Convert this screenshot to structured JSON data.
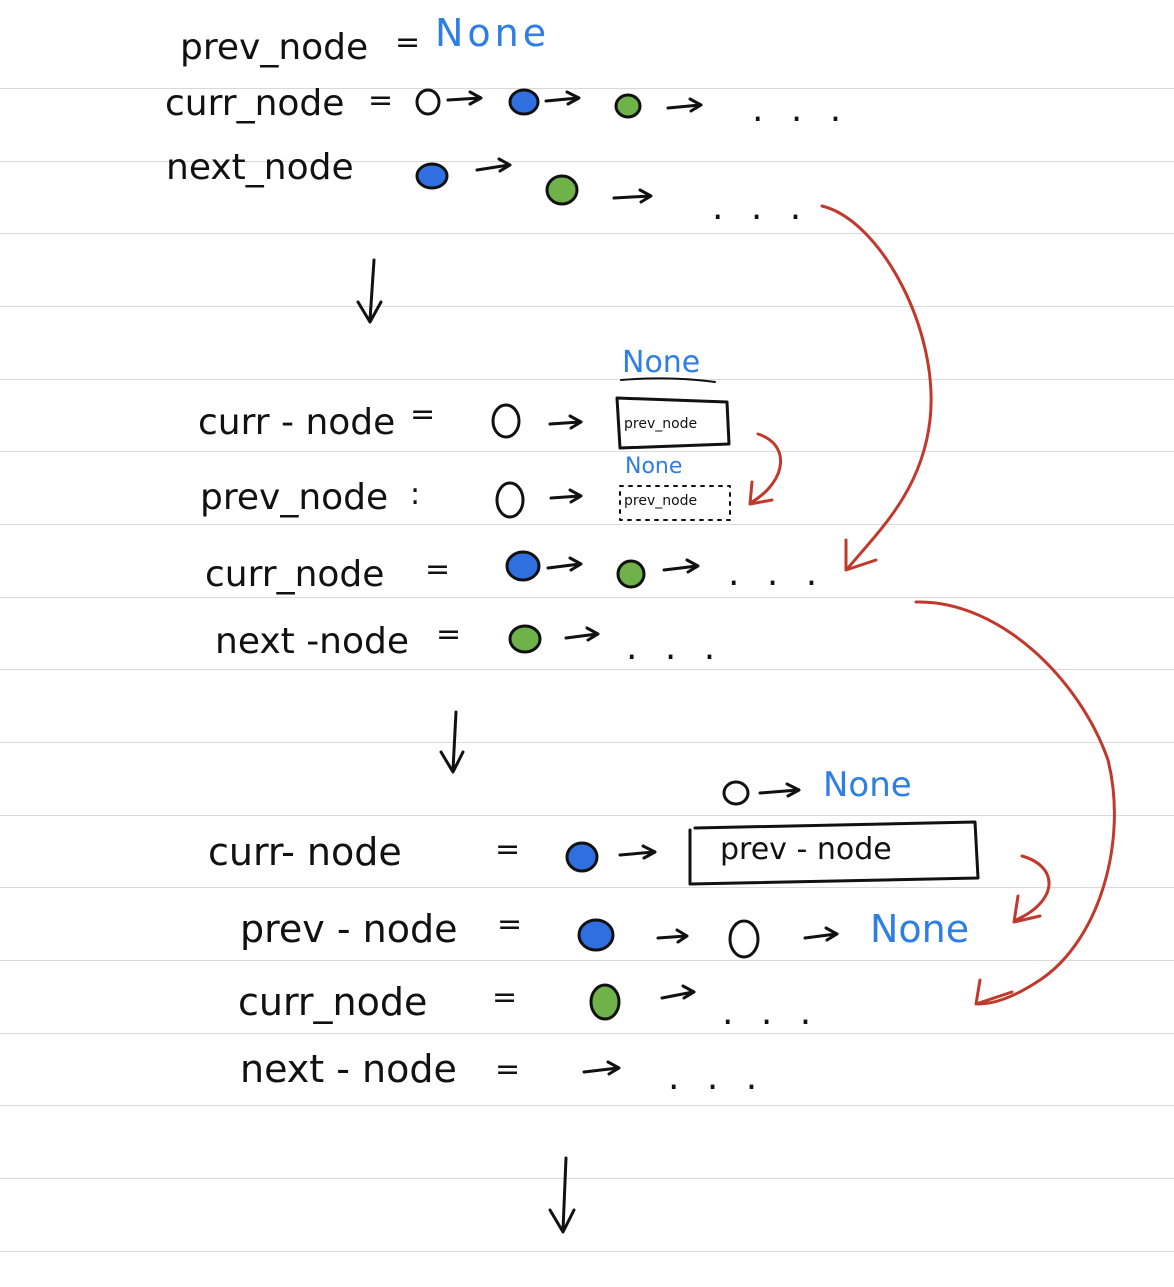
{
  "colors": {
    "ink": "#111111",
    "none_text": "#2f7ee6",
    "blue_node": "#2f6fe0",
    "green_node": "#6fb24a",
    "red_arrow": "#c0392b",
    "rule": "#d9d9d9"
  },
  "step1": {
    "prev_label": "prev_node",
    "prev_eq": "=",
    "prev_value": "None",
    "curr_label": "curr_node",
    "curr_eq": "=",
    "curr_tail": ". . .",
    "next_label": "next_node",
    "next_tail": ". . ."
  },
  "step2": {
    "curr_label": "curr - node",
    "curr_eq": "=",
    "none_top": "None",
    "box_prev": "prev_node",
    "prev_label": "prev_node",
    "prev_eq": ":",
    "none_small": "None",
    "box_prev_dotted": "prev_node",
    "curr2_label": "curr_node",
    "curr2_eq": "=",
    "curr2_tail": ". . .",
    "next_label": "next -node",
    "next_eq": "=",
    "next_tail": ". . ."
  },
  "step3": {
    "top_none": "None",
    "curr_label": "curr- node",
    "curr_eq": "=",
    "box_prev": "prev - node",
    "prev_label": "prev - node",
    "prev_eq": "=",
    "prev_none": "None",
    "curr2_label": "curr_node",
    "curr2_eq": "=",
    "curr2_tail": ". . .",
    "next_label": "next - node",
    "next_eq": "=",
    "next_tail": ". . ."
  }
}
